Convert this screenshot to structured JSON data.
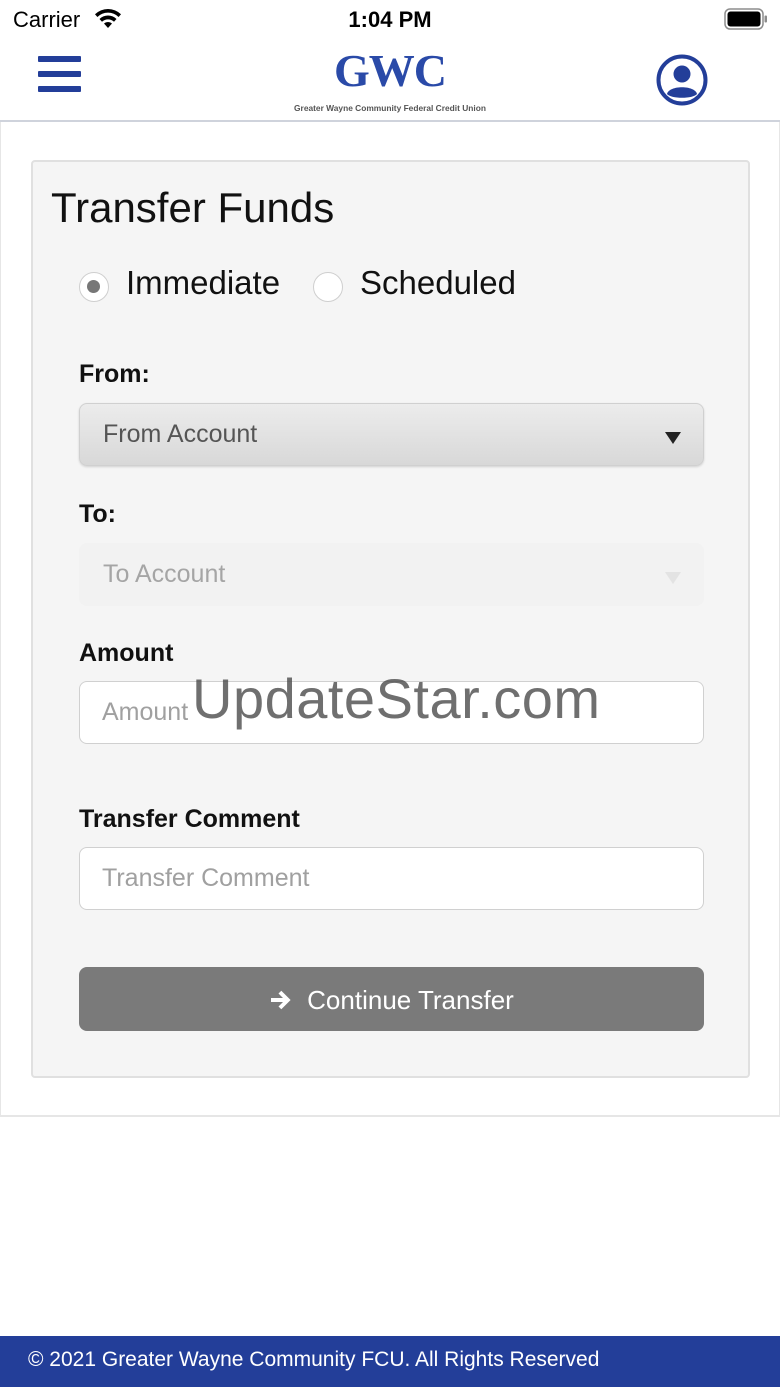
{
  "status_bar": {
    "carrier": "Carrier",
    "time": "1:04 PM"
  },
  "header": {
    "logo_text": "GWC",
    "logo_subtitle": "Greater Wayne Community Federal Credit Union",
    "brand_color": "#233e99"
  },
  "form": {
    "title": "Transfer Funds",
    "options": [
      {
        "label": "Immediate",
        "selected": true
      },
      {
        "label": "Scheduled",
        "selected": false
      }
    ],
    "from_label": "From:",
    "from_value": "From Account",
    "to_label": "To:",
    "to_value": "To Account",
    "amount_label": "Amount",
    "amount_placeholder": "Amount",
    "comment_label": "Transfer Comment",
    "comment_placeholder": "Transfer Comment",
    "continue_label": "Continue Transfer"
  },
  "watermark": "UpdateStar.com",
  "footer": {
    "copyright": "© 2021 Greater Wayne Community FCU. All Rights Reserved"
  }
}
